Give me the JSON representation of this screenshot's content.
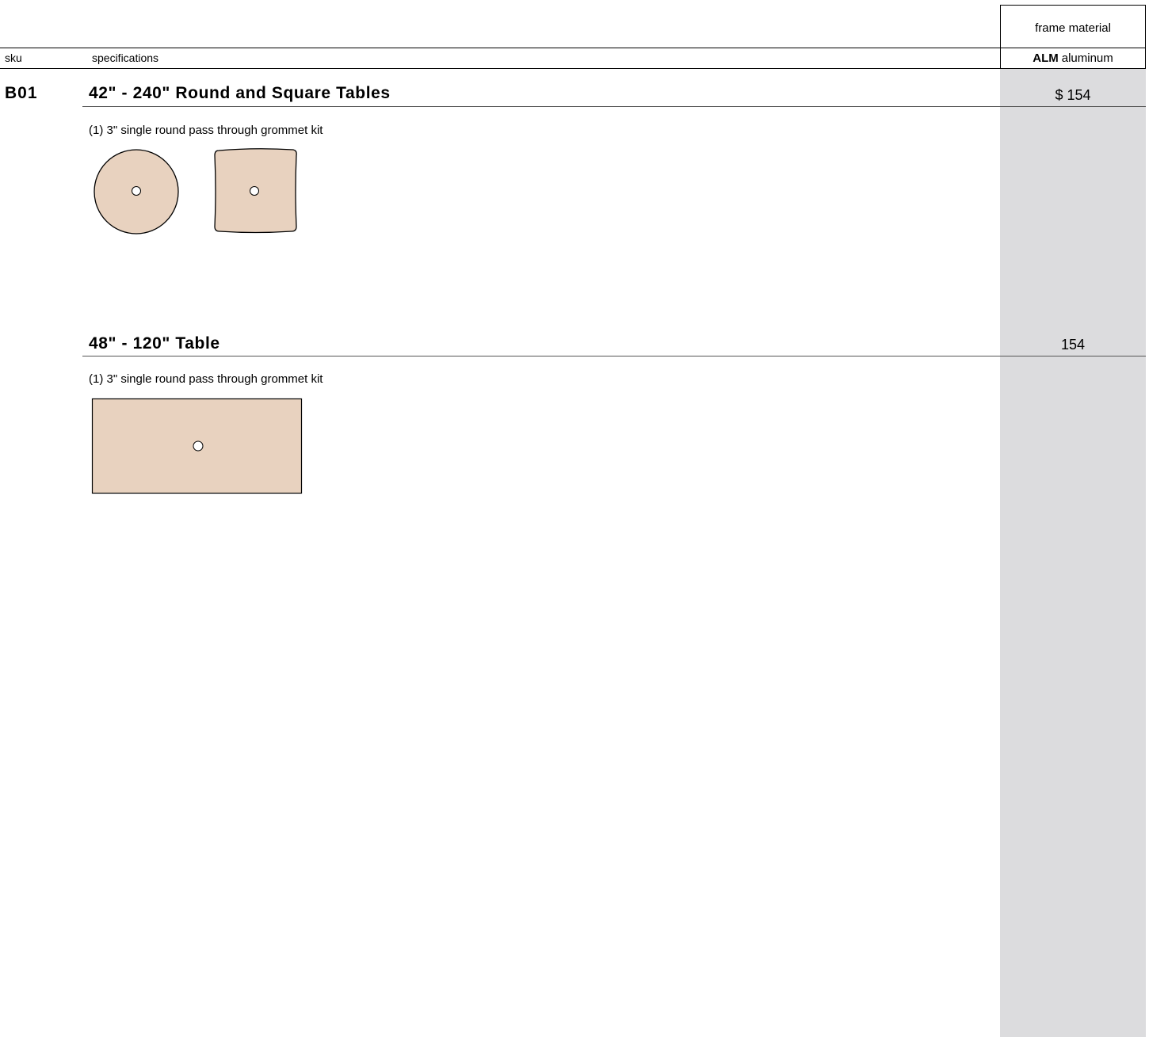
{
  "header": {
    "frame_material_label": "frame material",
    "sku_label": "sku",
    "specifications_label": "specifications",
    "material_code": "ALM",
    "material_name": "aluminum"
  },
  "product": {
    "sku": "B01",
    "items": [
      {
        "title": "42\" - 240\" Round and Square Tables",
        "price": "$ 154",
        "description": "(1) 3\" single round pass through grommet kit",
        "shapes": [
          "round-table-top",
          "square-table-top"
        ]
      },
      {
        "title": "48\" - 120\" Table",
        "price": "154",
        "description": "(1) 3\" single round pass through grommet kit",
        "shapes": [
          "rectangular-table-top"
        ]
      }
    ]
  },
  "colors": {
    "table_top_fill": "#e8d2bf",
    "price_column_bg": "#dcdcde"
  }
}
